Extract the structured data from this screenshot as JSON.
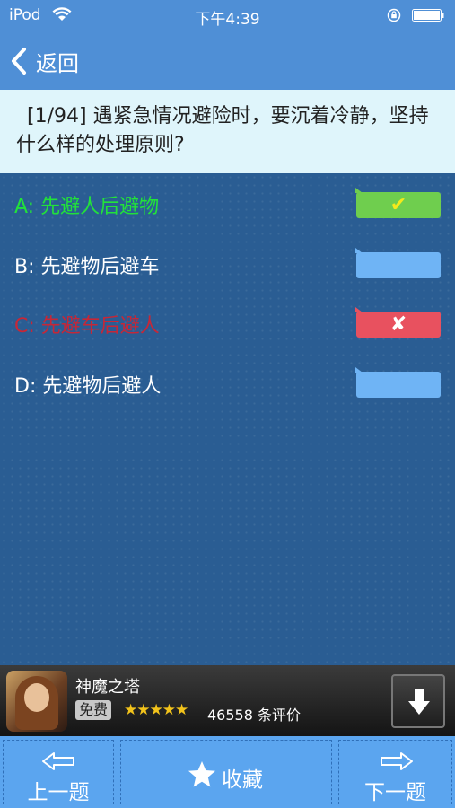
{
  "status_bar": {
    "carrier": "iPod",
    "time": "下午4:39"
  },
  "nav": {
    "back_label": "返回"
  },
  "question": {
    "text": "[1/94] 遇紧急情况避险时，要沉着冷静，坚持什么样的处理原则?"
  },
  "options": [
    {
      "label": "A: 先避人后避物",
      "state": "correct",
      "mark": "✔"
    },
    {
      "label": "B: 先避物后避车",
      "state": "neutral",
      "mark": ""
    },
    {
      "label": "C: 先避车后避人",
      "state": "wrong",
      "mark": "✘"
    },
    {
      "label": "D: 先避物后避人",
      "state": "neutral",
      "mark": ""
    }
  ],
  "ad": {
    "title": "神魔之塔",
    "price": "免费",
    "stars": "★★★★★",
    "rating_value": 4.5,
    "rating_count": "46558 条评价"
  },
  "toolbar": {
    "prev_label": "上一题",
    "favorite_label": "收藏",
    "next_label": "下一题"
  },
  "colors": {
    "nav_blue": "#4f8fd6",
    "background_blue": "#2a5d93",
    "correct_green": "#22e23a",
    "wrong_red": "#c62737"
  }
}
